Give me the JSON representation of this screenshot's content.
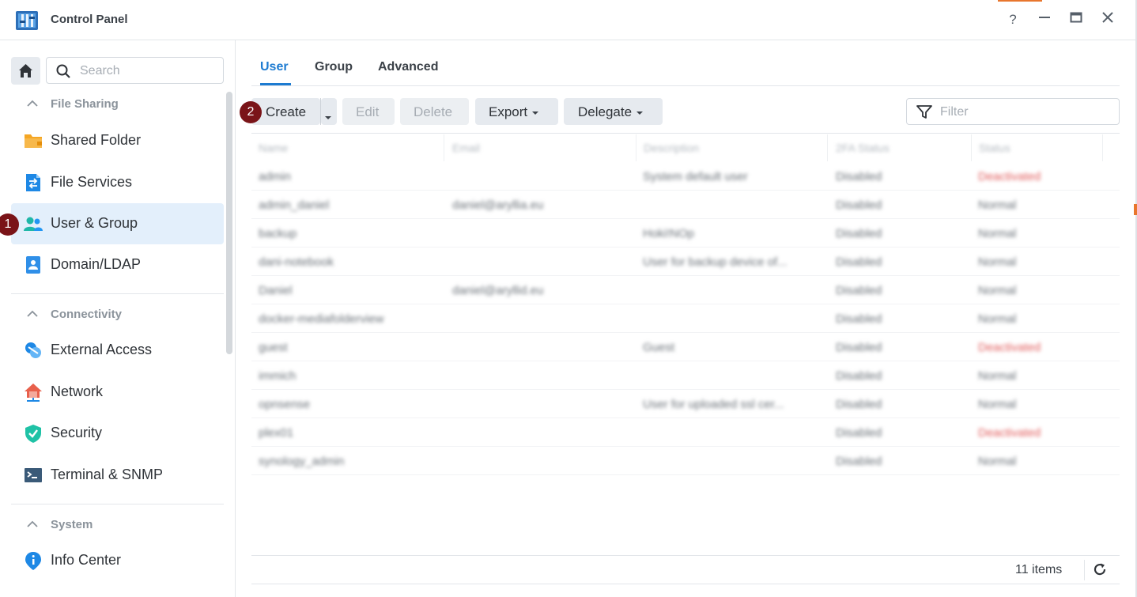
{
  "window": {
    "title": "Control Panel",
    "help": "?",
    "minimize": "—",
    "maximize": "▭",
    "close": "✕"
  },
  "sidebar": {
    "search_placeholder": "Search",
    "sections": [
      {
        "label": "File Sharing",
        "items": [
          {
            "label": "Shared Folder",
            "icon": "folder-icon",
            "color": "#f5a623"
          },
          {
            "label": "File Services",
            "icon": "file-services-icon",
            "color": "#1e88e5"
          },
          {
            "label": "User & Group",
            "icon": "users-icon",
            "color": "#1fb7a8",
            "active": true
          },
          {
            "label": "Domain/LDAP",
            "icon": "domain-icon",
            "color": "#2f8fe8"
          }
        ]
      },
      {
        "label": "Connectivity",
        "items": [
          {
            "label": "External Access",
            "icon": "external-access-icon",
            "color": "#1e88e5"
          },
          {
            "label": "Network",
            "icon": "network-icon",
            "color": "#e8604c"
          },
          {
            "label": "Security",
            "icon": "security-shield-icon",
            "color": "#1fc2a6"
          },
          {
            "label": "Terminal & SNMP",
            "icon": "terminal-icon",
            "color": "#3a5a78"
          }
        ]
      },
      {
        "label": "System",
        "items": [
          {
            "label": "Info Center",
            "icon": "info-icon",
            "color": "#1e88e5"
          }
        ]
      }
    ]
  },
  "annotations": {
    "badge1": "1",
    "badge2": "2",
    "badge_color": "#7a1418"
  },
  "main": {
    "tabs": [
      {
        "label": "User",
        "active": true
      },
      {
        "label": "Group"
      },
      {
        "label": "Advanced"
      }
    ],
    "toolbar": {
      "create": "Create",
      "edit": "Edit",
      "delete": "Delete",
      "export": "Export",
      "delegate": "Delegate",
      "filter_placeholder": "Filter"
    },
    "table": {
      "columns": [
        "Name",
        "Email",
        "Description",
        "2FA Status",
        "Status"
      ],
      "rows": [
        {
          "name": "admin",
          "email": "",
          "description": "System default user",
          "twofa": "Disabled",
          "status": "Deactivated",
          "status_red": true
        },
        {
          "name": "admin_daniel",
          "email": "daniel@aryllia.eu",
          "description": "",
          "twofa": "Disabled",
          "status": "Normal"
        },
        {
          "name": "backup",
          "email": "",
          "description": "Hoki!NOp",
          "twofa": "Disabled",
          "status": "Normal"
        },
        {
          "name": "dani-notebook",
          "email": "",
          "description": "User for backup device of...",
          "twofa": "Disabled",
          "status": "Normal"
        },
        {
          "name": "Daniel",
          "email": "daniel@aryllid.eu",
          "description": "",
          "twofa": "Disabled",
          "status": "Normal"
        },
        {
          "name": "docker-mediafolderview",
          "email": "",
          "description": "",
          "twofa": "Disabled",
          "status": "Normal"
        },
        {
          "name": "guest",
          "email": "",
          "description": "Guest",
          "twofa": "Disabled",
          "status": "Deactivated",
          "status_red": true
        },
        {
          "name": "immich",
          "email": "",
          "description": "",
          "twofa": "Disabled",
          "status": "Normal"
        },
        {
          "name": "opnsense",
          "email": "",
          "description": "User for uploaded ssl cer...",
          "twofa": "Disabled",
          "status": "Normal"
        },
        {
          "name": "plex01",
          "email": "",
          "description": "",
          "twofa": "Disabled",
          "status": "Deactivated",
          "status_red": true
        },
        {
          "name": "synology_admin",
          "email": "",
          "description": "",
          "twofa": "Disabled",
          "status": "Normal"
        }
      ]
    },
    "footer": {
      "items_count": "11 items"
    }
  }
}
